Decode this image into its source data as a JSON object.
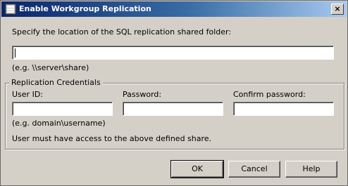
{
  "window": {
    "title": "Enable Workgroup Replication"
  },
  "share": {
    "prompt": "Specify the location of the SQL replication shared folder:",
    "value": "",
    "hint": "(e.g. \\\\server\\share)"
  },
  "credentials": {
    "group_label": "Replication Credentials",
    "user_id_label": "User ID:",
    "user_id_value": "",
    "user_id_hint": "(e.g. domain\\username)",
    "password_label": "Password:",
    "confirm_password_label": "Confirm password:",
    "access_note": "User must have access to the above defined share."
  },
  "buttons": {
    "ok": "OK",
    "cancel": "Cancel",
    "help": "Help"
  },
  "icons": {
    "title": "database-icon",
    "close": "close-icon"
  }
}
